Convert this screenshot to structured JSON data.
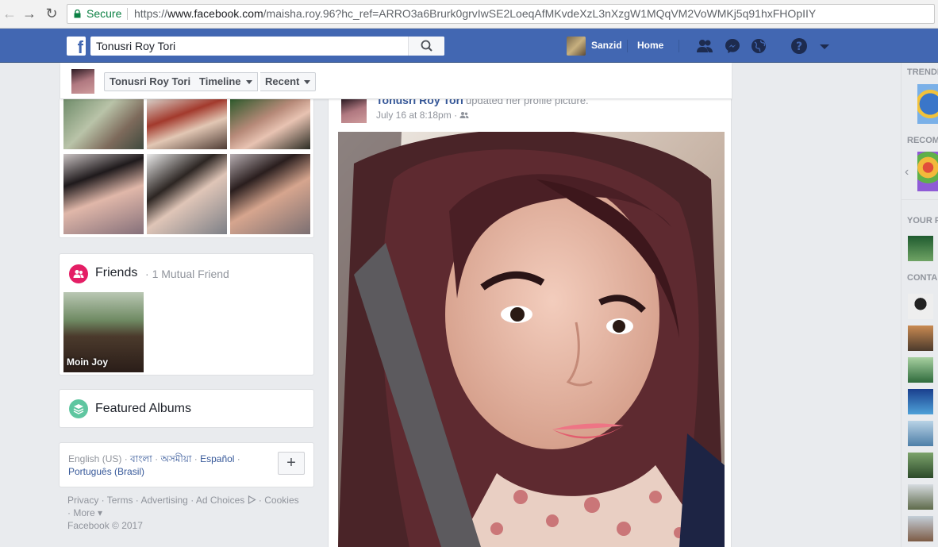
{
  "browser": {
    "secure_label": "Secure",
    "url_scheme": "https://",
    "url_domain": "www.facebook.com",
    "url_path": "/maisha.roy.96?hc_ref=ARRO3a6Brurk0grvIwSE2LoeqAfMKvdeXzL3nXzgW1MQqVM2VoWMKj5q91hxFHOpIIY"
  },
  "topbar": {
    "logo": "f",
    "search_value": "Tonusri Roy Tori",
    "user_name": "Sanzid",
    "home_label": "Home",
    "brand_color": "#4267b2"
  },
  "sticky": {
    "profile_name": "Tonusri Roy Tori",
    "timeline_label": "Timeline",
    "recent_label": "Recent"
  },
  "friends": {
    "title": "Friends",
    "subtitle": "1 Mutual Friend",
    "friend_name": "Moin Joy"
  },
  "albums": {
    "title": "Featured Albums"
  },
  "languages": {
    "current": "English (US)",
    "options": [
      "বাংলা",
      "অসমীয়া",
      "Español",
      "Português (Brasil)"
    ],
    "add_label": "+"
  },
  "footer": {
    "links": [
      "Privacy",
      "Terms",
      "Advertising",
      "Ad Choices",
      "Cookies",
      "More"
    ],
    "copyright": "Facebook © 2017"
  },
  "post": {
    "author": "Tonusri Roy Tori",
    "action": "updated her profile picture.",
    "time": "July 16 at 8:18pm"
  },
  "right_rail": {
    "trending_label": "TRENDI",
    "recommended_label": "RECOM",
    "your_label": "YOUR P",
    "contacts_label": "CONTA"
  }
}
